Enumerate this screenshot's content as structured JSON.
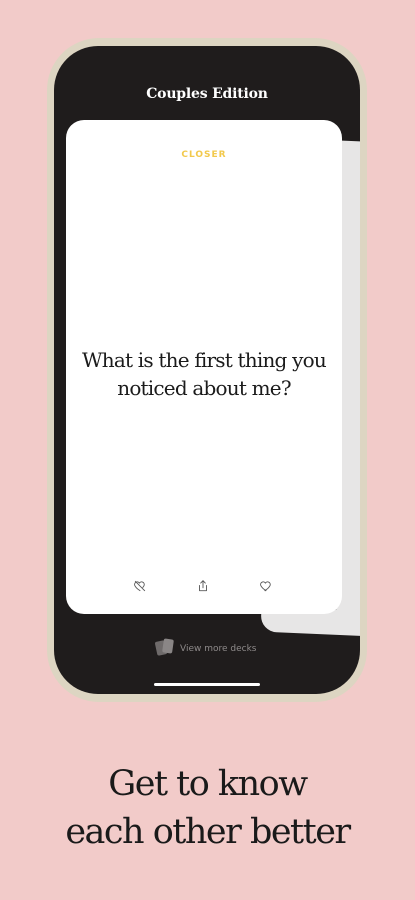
{
  "app": {
    "title": "Couples Edition"
  },
  "card": {
    "category": "CLOSER",
    "question": "What is the first thing you noticed about me?",
    "actions": [
      {
        "icon": "heart-off-icon"
      },
      {
        "icon": "share-icon"
      },
      {
        "icon": "heart-icon"
      }
    ]
  },
  "footer": {
    "more_decks_label": "View more decks",
    "more_decks_icon": "cards-icon"
  },
  "headline": {
    "line1": "Get to know",
    "line2": "each other better"
  },
  "colors": {
    "background": "#f2cbc9",
    "phone_frame": "#ddd5c2",
    "screen": "#1f1c1c",
    "category_accent": "#f2c94c"
  }
}
